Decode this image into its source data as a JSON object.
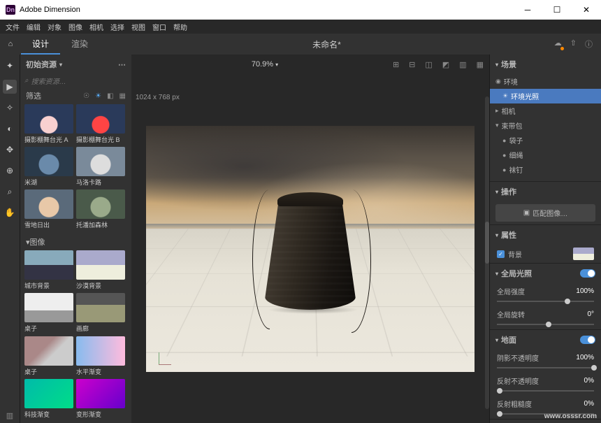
{
  "app": {
    "title": "Adobe Dimension"
  },
  "menus": [
    "文件",
    "编辑",
    "对象",
    "图像",
    "相机",
    "选择",
    "视图",
    "窗口",
    "帮助"
  ],
  "topbar": {
    "tabs": [
      {
        "label": "设计",
        "active": true
      },
      {
        "label": "渲染",
        "active": false
      }
    ],
    "doc_title": "未命名*"
  },
  "zoom": "70.9%",
  "canvas_dim": "1024 x 768 px",
  "assets": {
    "title": "初始资源",
    "search_placeholder": "搜索资源…",
    "section1": {
      "title": "筛选",
      "items": [
        {
          "label": "摄影棚舞台光 A",
          "bg": "radial-gradient(circle at 50% 70%, #f8d0d0 12px, #2a3a5a 13px)"
        },
        {
          "label": "摄影棚舞台光 B",
          "bg": "radial-gradient(circle at 50% 70%, #f44 12px, #2a3a5a 13px)"
        },
        {
          "label": "米湖",
          "bg": "radial-gradient(circle at 50% 60%, #6a8aaa 14px, #2a3a4a 15px)"
        },
        {
          "label": "马洛卡路",
          "bg": "radial-gradient(circle at 50% 60%, #ddd 14px, #7a8a9a 15px)"
        },
        {
          "label": "雪地日出",
          "bg": "radial-gradient(circle at 50% 60%, #e8c8a8 14px, #5a6a7a 15px)"
        },
        {
          "label": "托潘加森林",
          "bg": "radial-gradient(circle at 50% 60%, #9aaa8a 14px, #4a5a4a 15px)"
        }
      ]
    },
    "section2": {
      "title": "图像",
      "items": [
        {
          "label": "城市背景",
          "bg": "linear-gradient(to bottom, #8ab 50%, #334 50%)"
        },
        {
          "label": "沙漠背景",
          "bg": "linear-gradient(to bottom, #aac 50%, #eed 50%)"
        },
        {
          "label": "桌子",
          "bg": "linear-gradient(to bottom, #eee 60%, #999 60%)"
        },
        {
          "label": "画廊",
          "bg": "linear-gradient(to bottom, #555 40%, #997 40%)"
        },
        {
          "label": "桌子",
          "bg": "linear-gradient(135deg, #a88 40%, #ccc 60%)"
        },
        {
          "label": "水平渐变",
          "bg": "linear-gradient(to right, #8be, #fbd)"
        },
        {
          "label": "科技渐变",
          "bg": "linear-gradient(135deg, #0ba, #0d8)"
        },
        {
          "label": "变形渐变",
          "bg": "linear-gradient(135deg, #c0c, #60c)"
        }
      ]
    }
  },
  "scene": {
    "title": "场景",
    "nodes": [
      {
        "label": "环境",
        "depth": 0,
        "icon": "◉",
        "sel": false
      },
      {
        "label": "环境光照",
        "depth": 1,
        "icon": "☀",
        "sel": true
      },
      {
        "label": "相机",
        "depth": 0,
        "icon": "▸",
        "sel": false
      },
      {
        "label": "束带包",
        "depth": 0,
        "icon": "▾",
        "sel": false
      },
      {
        "label": "袋子",
        "depth": 1,
        "icon": "●",
        "sel": false
      },
      {
        "label": "细绳",
        "depth": 1,
        "icon": "●",
        "sel": false
      },
      {
        "label": "袜钉",
        "depth": 1,
        "icon": "●",
        "sel": false
      }
    ]
  },
  "actions": {
    "title": "操作",
    "match_btn": "匹配图像…"
  },
  "props": {
    "title": "属性",
    "bg_label": "背景"
  },
  "global_light": {
    "title": "全局光照",
    "intensity": {
      "label": "全局强度",
      "value": "100%",
      "pos": 70
    },
    "rotation": {
      "label": "全局旋转",
      "value": "0°",
      "pos": 50
    }
  },
  "ground": {
    "title": "地面",
    "shadow_opacity": {
      "label": "阴影不透明度",
      "value": "100%",
      "pos": 100
    },
    "refl_opacity": {
      "label": "反射不透明度",
      "value": "0%",
      "pos": 0
    },
    "refl_rough": {
      "label": "反射粗糙度",
      "value": "0%",
      "pos": 0
    }
  },
  "watermark": "www.osssr.com"
}
